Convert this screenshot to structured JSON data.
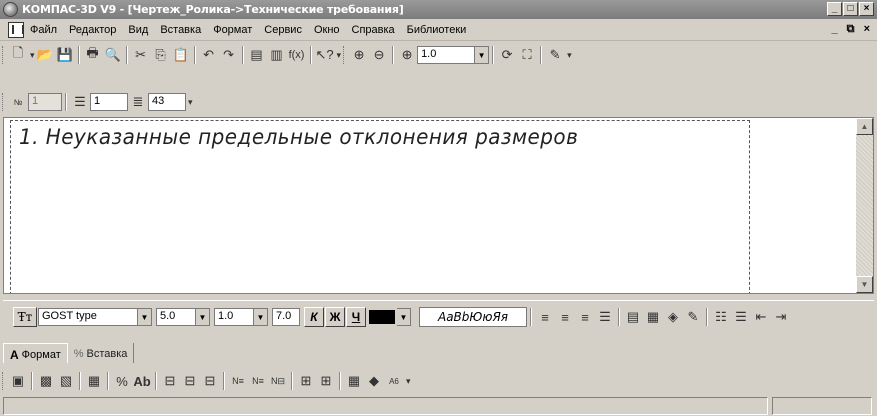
{
  "window": {
    "title": "КОМПАС-3D V9 - [Чертеж_Ролика->Технические требования]",
    "controls": [
      "_",
      "□",
      "×"
    ]
  },
  "menu": {
    "items": [
      "Файл",
      "Редактор",
      "Вид",
      "Вставка",
      "Формат",
      "Сервис",
      "Окно",
      "Справка",
      "Библиотеки"
    ],
    "mdi_controls": "_ ⧉ ×"
  },
  "toolbar_standard": {
    "zoom_value": "1.0"
  },
  "toolbar_numbering": {
    "field1": "1",
    "field2": "1",
    "field3": "43"
  },
  "document": {
    "requirement_line": "1. Неуказанные предельные отклонения размеров"
  },
  "format_bar": {
    "font": "GOST type",
    "size": "5.0",
    "stretch": "1.0",
    "step": "7.0",
    "style_buttons": [
      "К",
      "Ж",
      "Ч"
    ],
    "sample_text": "АаBbЮюЯя",
    "text_color": "#000000"
  },
  "tabs": [
    {
      "label": "Формат",
      "icon": "A"
    },
    {
      "label": "Вставка",
      "icon": "%"
    }
  ]
}
